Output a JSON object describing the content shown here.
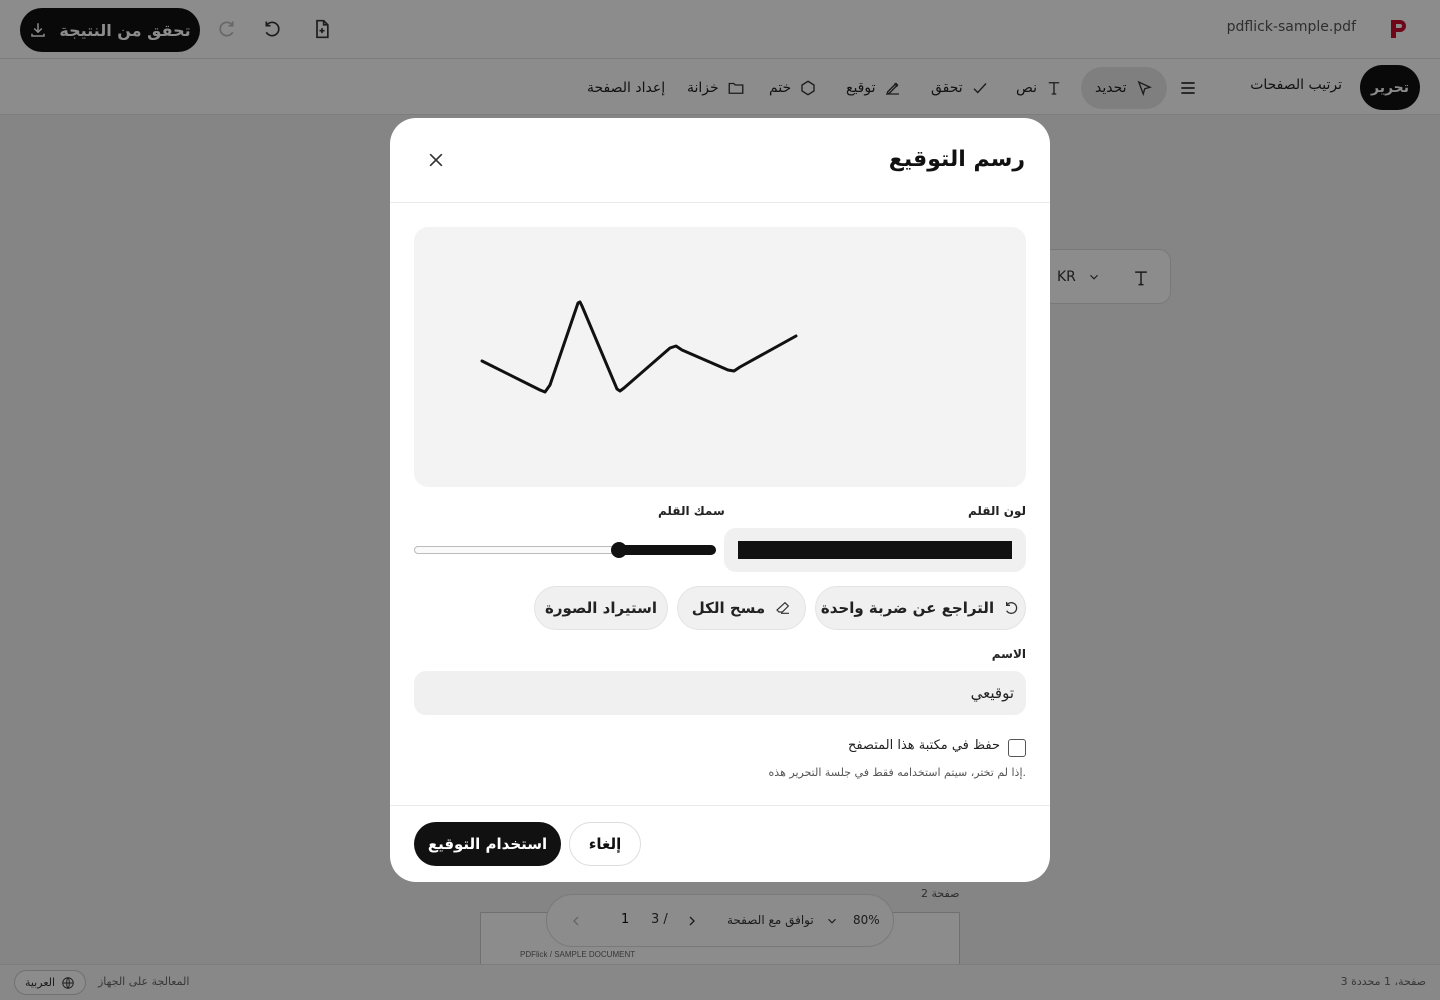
{
  "app": {
    "filename": "pdflick-sample.pdf",
    "verify_label": "تحقق من النتيجة"
  },
  "toolbar": {
    "edit_label": "تحرير",
    "pages_label": "ترتيب الصفحات",
    "tools": [
      {
        "label": "تحديد",
        "icon": "cursor-icon"
      },
      {
        "label": "نص",
        "icon": "text-icon"
      },
      {
        "label": "تحقق",
        "icon": "check-icon"
      },
      {
        "label": "توقيع",
        "icon": "signature-pen-icon"
      },
      {
        "label": "ختم",
        "icon": "stamp-icon"
      },
      {
        "label": "خزانة",
        "icon": "folder-icon"
      },
      {
        "label": "إعداد الصفحة",
        "icon": ""
      }
    ]
  },
  "text_float": {
    "font_label": "KR"
  },
  "document": {
    "page_count_label": "2 صفحة",
    "thumb_text": "PDFlick / SAMPLE DOCUMENT"
  },
  "pager": {
    "zoom": "80%",
    "fit_label": "توافق مع الصفحة",
    "total": "3 /",
    "current": "1"
  },
  "status": {
    "selection": "3 صفحة، 1 محددة",
    "language": "العربية",
    "processing": "المعالجة على الجهاز"
  },
  "dialog": {
    "title": "رسم التوقيع",
    "pen_color_label": "لون القلم",
    "pen_color": "#111111",
    "pen_width_label": "سمك القلم",
    "pen_width_level": 0.68,
    "undo_label": "التراجع عن ضربة واحدة",
    "clear_label": "مسح الكل",
    "import_label": "استيراد الصورة",
    "name_label": "الاسم",
    "name_value": "توقيعي",
    "save_label": "حفظ في مكتبة هذا المتصفح",
    "hint": "إذا لم تختر، سيتم استخدامه فقط في جلسة التحرير هذه.",
    "cancel_label": "إلغاء",
    "use_label": "استخدام التوقيع"
  }
}
